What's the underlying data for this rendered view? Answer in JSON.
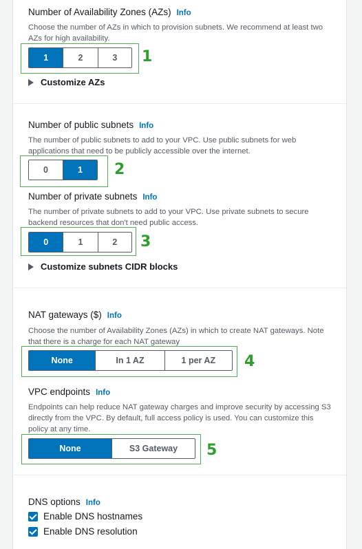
{
  "info_label": "Info",
  "az": {
    "title": "Number of Availability Zones (AZs)",
    "description": "Choose the number of AZs in which to provision subnets. We recommend at least two AZs for high availability.",
    "options": [
      "1",
      "2",
      "3"
    ],
    "selected": "1",
    "customize_label": "Customize AZs",
    "callout_number": "1"
  },
  "public_subnets": {
    "title": "Number of public subnets",
    "description": "The number of public subnets to add to your VPC. Use public subnets for web applications that need to be publicly accessible over the internet.",
    "options": [
      "0",
      "1"
    ],
    "selected": "1",
    "callout_number": "2"
  },
  "private_subnets": {
    "title": "Number of private subnets",
    "description": "The number of private subnets to add to your VPC. Use private subnets to secure backend resources that don't need public access.",
    "options": [
      "0",
      "1",
      "2"
    ],
    "selected": "0",
    "customize_label": "Customize subnets CIDR blocks",
    "callout_number": "3"
  },
  "nat": {
    "title": "NAT gateways ($)",
    "description": "Choose the number of Availability Zones (AZs) in which to create NAT gateways. Note that there is a charge for each NAT gateway",
    "options": [
      "None",
      "In 1 AZ",
      "1 per AZ"
    ],
    "selected": "None",
    "callout_number": "4"
  },
  "vpc_endpoints": {
    "title": "VPC endpoints",
    "description": "Endpoints can help reduce NAT gateway charges and improve security by accessing S3 directly from the VPC. By default, full access policy is used. You can customize this policy at any time.",
    "options": [
      "None",
      "S3 Gateway"
    ],
    "selected": "None",
    "callout_number": "5"
  },
  "dns": {
    "title": "DNS options",
    "hostnames_label": "Enable DNS hostnames",
    "hostnames_checked": true,
    "resolution_label": "Enable DNS resolution",
    "resolution_checked": true
  },
  "colors": {
    "selected": "#0073bb",
    "callout_border": "#4caf50",
    "callout_number": "#2e9e2e",
    "info_link": "#0073bb"
  }
}
